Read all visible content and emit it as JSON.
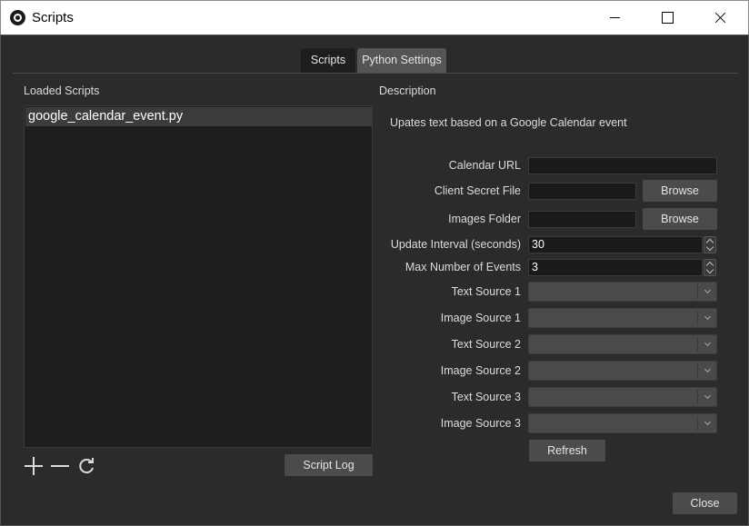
{
  "window": {
    "title": "Scripts"
  },
  "tabs": [
    {
      "label": "Scripts",
      "active": true
    },
    {
      "label": "Python Settings",
      "active": false
    }
  ],
  "loaded_scripts": {
    "heading": "Loaded Scripts",
    "items": [
      "google_calendar_event.py"
    ],
    "script_log_label": "Script Log"
  },
  "description": {
    "heading": "Description",
    "text": "Upates text based on a Google Calendar event"
  },
  "settings": {
    "calendar_url": {
      "label": "Calendar URL",
      "value": ""
    },
    "client_secret_file": {
      "label": "Client Secret File",
      "value": "",
      "button": "Browse"
    },
    "images_folder": {
      "label": "Images Folder",
      "value": "",
      "button": "Browse"
    },
    "update_interval": {
      "label": "Update Interval (seconds)",
      "value": "30"
    },
    "max_events": {
      "label": "Max Number of Events",
      "value": "3"
    },
    "sources": [
      {
        "label": "Text Source 1",
        "value": ""
      },
      {
        "label": "Image Source 1",
        "value": ""
      },
      {
        "label": "Text Source 2",
        "value": ""
      },
      {
        "label": "Image Source 2",
        "value": ""
      },
      {
        "label": "Text Source 3",
        "value": ""
      },
      {
        "label": "Image Source 3",
        "value": ""
      }
    ],
    "refresh_label": "Refresh"
  },
  "close_label": "Close",
  "colors": {
    "background": "#2b2b2b",
    "list_background": "#1e1e1e",
    "button": "#4b4b4b"
  }
}
